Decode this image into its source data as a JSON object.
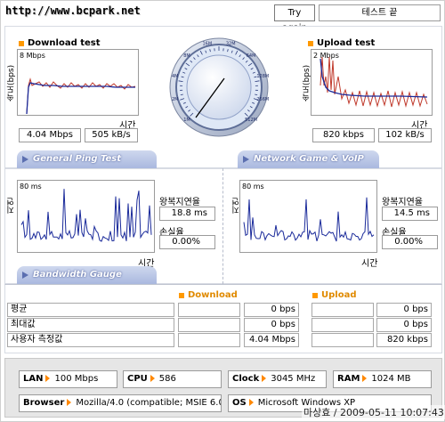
{
  "header": {
    "url": "http://www.bcpark.net",
    "try_again": "Try again",
    "test_status": "테스트 끝"
  },
  "download": {
    "title": "Download test",
    "scale": "8 Mbps",
    "axis_y": "속도(bps)",
    "axis_x": "시간",
    "mbps": "4.04 Mbps",
    "kbs": "505 kB/s"
  },
  "upload": {
    "title": "Upload test",
    "scale": "2 Mbps",
    "axis_y": "속도(bps)",
    "axis_x": "시간",
    "kbps": "820 kbps",
    "kbs": "102 kB/s"
  },
  "gauge": {
    "labels": [
      "1M",
      "2M",
      "4M",
      "8M",
      "16M",
      "32M",
      "64M",
      "128M",
      "256M",
      "512M"
    ],
    "needle_value": "4.04 Mbps"
  },
  "ping": {
    "tab": "General Ping Test",
    "scale": "80 ms",
    "axis_y": "지연(ms)",
    "axis_x": "시간",
    "latency_label": "왕복지연율",
    "latency": "18.8 ms",
    "loss_label": "손실율",
    "loss": "0.00%"
  },
  "game": {
    "tab": "Network Game & VoIP Test",
    "scale": "80 ms",
    "axis_y": "지연(ms)",
    "axis_x": "시간",
    "latency_label": "왕복지연율",
    "latency": "14.5 ms",
    "loss_label": "손실율",
    "loss": "0.00%"
  },
  "bandwidth": {
    "tab": "Bandwidth Gauge",
    "col_download": "Download",
    "col_upload": "Upload",
    "rows": [
      {
        "label": "평균",
        "download": "0 bps",
        "upload": "0 bps"
      },
      {
        "label": "최대값",
        "download": "0 bps",
        "upload": "0 bps"
      },
      {
        "label": "사용자 측정값",
        "download": "4.04 Mbps",
        "upload": "820 kbps"
      }
    ]
  },
  "specs": {
    "lan_label": "LAN",
    "lan": "100 Mbps",
    "cpu_label": "CPU",
    "cpu": "586",
    "clock_label": "Clock",
    "clock": "3045 MHz",
    "ram_label": "RAM",
    "ram": "1024 MB",
    "browser_label": "Browser",
    "browser": "Mozilla/4.0 (compatible; MSIE 6.0",
    "os_label": "OS",
    "os": "Microsoft Windows XP"
  },
  "footer": {
    "signature": "마상효 / 2009-05-11 10:07:43"
  },
  "colors": {
    "orange": "#ff9900",
    "tab_blue": "#a9b8df",
    "series_blue": "#1a2a9a",
    "series_red": "#c0392b"
  }
}
